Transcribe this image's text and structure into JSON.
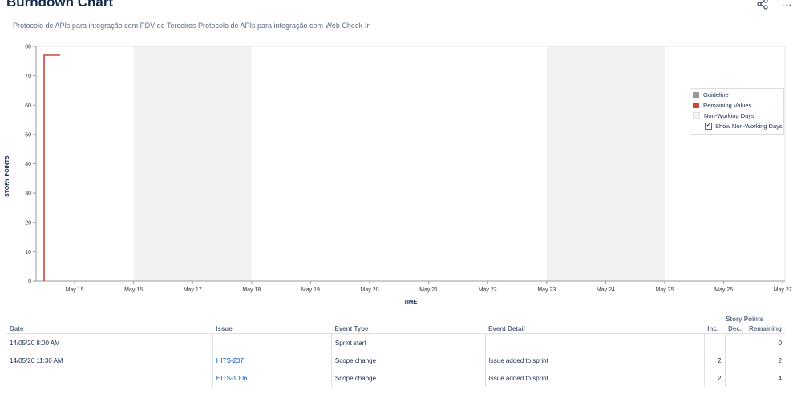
{
  "header": {
    "title": "Burndown Chart",
    "subtitle": "Protocolo de APIs para integração com PDV de Terceiros Protocolo de APIs para integração com Web Check-In",
    "share_icon": "share-icon",
    "more_icon": "more-icon",
    "more_label": "···"
  },
  "chart_data": {
    "type": "line",
    "xlabel": "TIME",
    "ylabel": "STORY POINTS",
    "ylim": [
      0,
      80
    ],
    "yticks": [
      "0",
      "10",
      "20",
      "30",
      "40",
      "50",
      "60",
      "70",
      "80"
    ],
    "xticks": [
      "May 15",
      "May 16",
      "May 17",
      "May 18",
      "May 19",
      "May 20",
      "May 21",
      "May 22",
      "May 23",
      "May 24",
      "May 25",
      "May 26",
      "May 27"
    ],
    "non_working_days": [
      [
        "May 16",
        "May 18"
      ],
      [
        "May 23",
        "May 25"
      ]
    ],
    "series": [
      {
        "name": "Remaining Values",
        "color": "#d04437",
        "points": [
          [
            "May 14",
            0
          ],
          [
            "May 14",
            77
          ],
          [
            "May 14",
            77
          ]
        ]
      }
    ],
    "legend": {
      "placement": "top-right",
      "items": [
        {
          "label": "Guideline",
          "color": "#999999"
        },
        {
          "label": "Remaining Values",
          "color": "#d04437"
        },
        {
          "label": "Non-Working Days",
          "color": "#f5f5f5"
        }
      ],
      "checkbox": {
        "label": "Show Non-Working Days",
        "checked": true
      }
    }
  },
  "table": {
    "story_points_label": "Story Points",
    "columns": {
      "date": "Date",
      "issue": "Issue",
      "event_type": "Event Type",
      "event_detail": "Event Detail",
      "inc": "Inc.",
      "dec": "Dec.",
      "remaining": "Remaining"
    },
    "rows": [
      {
        "date": "14/05/20 8:00 AM",
        "issue": "",
        "event_type": "Sprint start",
        "event_detail": "",
        "inc": "",
        "dec": "",
        "remaining": "0"
      },
      {
        "date": "14/05/20 11:30 AM",
        "issue": "HITS-207",
        "event_type": "Scope change",
        "event_detail": "Issue added to sprint",
        "inc": "2",
        "dec": "",
        "remaining": "2"
      },
      {
        "date": "",
        "issue": "HITS-1006",
        "event_type": "Scope change",
        "event_detail": "Issue added to sprint",
        "inc": "2",
        "dec": "",
        "remaining": "4"
      }
    ]
  }
}
